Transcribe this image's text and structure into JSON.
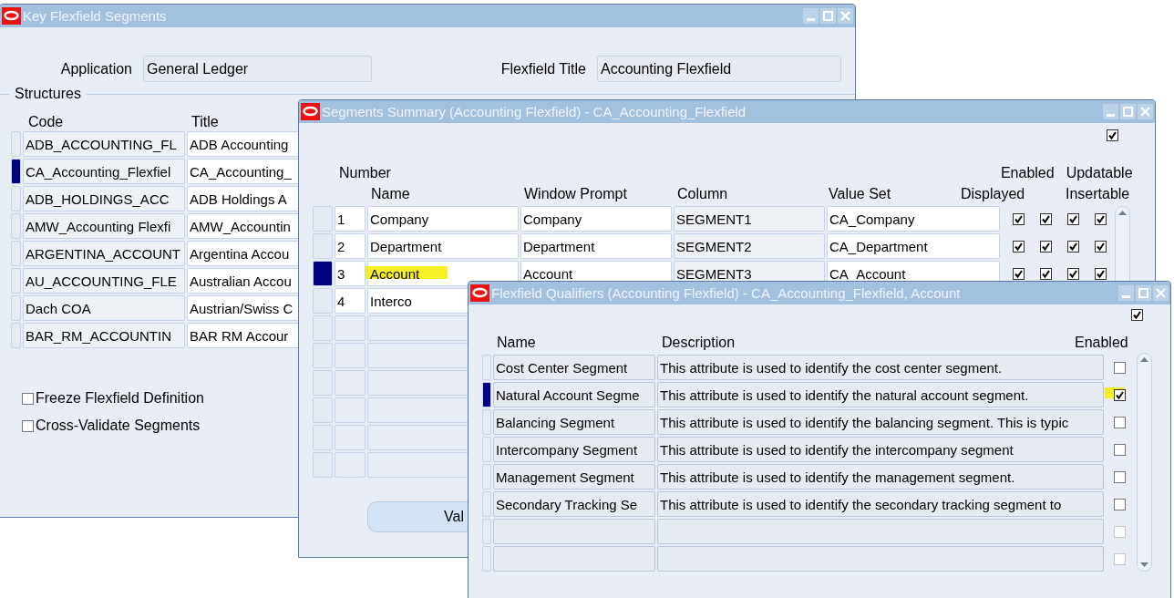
{
  "key_flexfield_window": {
    "title": "Key Flexfield Segments",
    "fields": [
      {
        "label": "Application",
        "value": "General Ledger"
      },
      {
        "label": "Flexfield Title",
        "value": "Accounting Flexfield"
      }
    ],
    "group_label": "Structures",
    "columns": [
      "Code",
      "Title"
    ],
    "rows": [
      {
        "code": "ADB_ACCOUNTING_FL",
        "title": "ADB Accounting",
        "selected": false
      },
      {
        "code": "CA_Accounting_Flexfiel",
        "title": "CA_Accounting_",
        "selected": true
      },
      {
        "code": "ADB_HOLDINGS_ACC",
        "title": "ADB Holdings A",
        "selected": false
      },
      {
        "code": "AMW_Accounting Flexfi",
        "title": "AMW_Accountin",
        "selected": false
      },
      {
        "code": "ARGENTINA_ACCOUNT",
        "title": "Argentina Accou",
        "selected": false
      },
      {
        "code": "AU_ACCOUNTING_FLE",
        "title": "Australian Accou",
        "selected": false
      },
      {
        "code": "Dach COA",
        "title": "Austrian/Swiss C",
        "selected": false
      },
      {
        "code": "BAR_RM_ACCOUNTIN",
        "title": "BAR RM Accour",
        "selected": false
      }
    ],
    "options": [
      {
        "label": "Freeze Flexfield Definition",
        "checked": false
      },
      {
        "label": "Cross-Validate Segments",
        "checked": false
      }
    ]
  },
  "segments_window": {
    "title": "Segments Summary (Accounting Flexfield) - CA_Accounting_Flexfield",
    "header_checkbox": {
      "checked": true
    },
    "columns": {
      "number": "Number",
      "name": "Name",
      "window_prompt": "Window Prompt",
      "column": "Column",
      "value_set": "Value Set",
      "displayed": "Displayed",
      "enabled": "Enabled",
      "insertable": "Insertable",
      "updatable": "Updatable"
    },
    "rows": [
      {
        "number": "1",
        "name": "Company",
        "window_prompt": "Company",
        "column": "SEGMENT1",
        "value_set": "CA_Company",
        "displayed": true,
        "enabled": true,
        "insertable": true,
        "updatable": true,
        "selected": false
      },
      {
        "number": "2",
        "name": "Department",
        "window_prompt": "Department",
        "column": "SEGMENT2",
        "value_set": "CA_Department",
        "displayed": true,
        "enabled": true,
        "insertable": true,
        "updatable": true,
        "selected": false
      },
      {
        "number": "3",
        "name": "Account",
        "window_prompt": "Account",
        "column": "SEGMENT3",
        "value_set": "CA_Account",
        "displayed": true,
        "enabled": true,
        "insertable": true,
        "updatable": true,
        "selected": true,
        "highlighted": true
      },
      {
        "number": "4",
        "name": "Interco",
        "selected": false
      }
    ],
    "button": "Val"
  },
  "qualifiers_window": {
    "title": "Flexfield Qualifiers (Accounting Flexfield) - CA_Accounting_Flexfield, Account",
    "header_checkbox": {
      "checked": true
    },
    "columns": {
      "name": "Name",
      "description": "Description",
      "enabled": "Enabled"
    },
    "rows": [
      {
        "name": "Cost Center Segment",
        "description": "This attribute is used to identify the cost center segment.",
        "enabled": false,
        "disabled": false,
        "selected": false
      },
      {
        "name": "Natural Account Segme",
        "description": "This attribute is used to identify the natural account segment.",
        "enabled": true,
        "disabled": false,
        "selected": true,
        "highlighted": true
      },
      {
        "name": "Balancing Segment",
        "description": "This attribute is used to identify the balancing segment. This is typic",
        "enabled": false,
        "disabled": false,
        "selected": false
      },
      {
        "name": "Intercompany Segment",
        "description": "This attribute is used to identify the intercompany segment",
        "enabled": false,
        "disabled": false,
        "selected": false
      },
      {
        "name": "Management Segment",
        "description": "This attribute is used to identify the management segment.",
        "enabled": false,
        "disabled": false,
        "selected": false
      },
      {
        "name": "Secondary Tracking Se",
        "description": "This attribute is used to identify the secondary tracking segment to",
        "enabled": false,
        "disabled": false,
        "selected": false
      },
      {
        "enabled": false,
        "disabled": true,
        "selected": false
      },
      {
        "enabled": false,
        "disabled": true,
        "selected": false
      }
    ]
  }
}
